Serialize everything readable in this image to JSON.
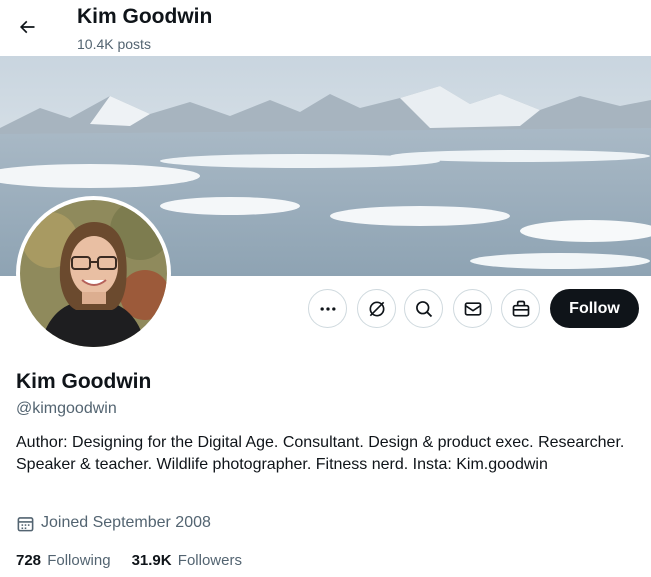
{
  "header": {
    "title": "Kim Goodwin",
    "posts_count": "10.4K posts",
    "back_icon": "arrow-left-icon"
  },
  "profile": {
    "display_name": "Kim Goodwin",
    "handle": "@kimgoodwin",
    "bio": "Author: Designing for the Digital Age. Consultant. Design & product exec. Researcher. Speaker & teacher. Wildlife photographer. Fitness nerd. Insta: Kim.goodwin",
    "joined": "Joined September 2008",
    "following_count": "728",
    "following_label": "Following",
    "followers_count": "31.9K",
    "followers_label": "Followers"
  },
  "actions": {
    "more_icon": "more-icon",
    "grok_icon": "grok-icon",
    "search_icon": "search-icon",
    "message_icon": "mail-icon",
    "gift_icon": "gift-icon",
    "follow_label": "Follow"
  },
  "colors": {
    "text_primary": "#0f1419",
    "text_secondary": "#536471",
    "border": "#cfd9de",
    "follow_bg": "#0f1419"
  }
}
